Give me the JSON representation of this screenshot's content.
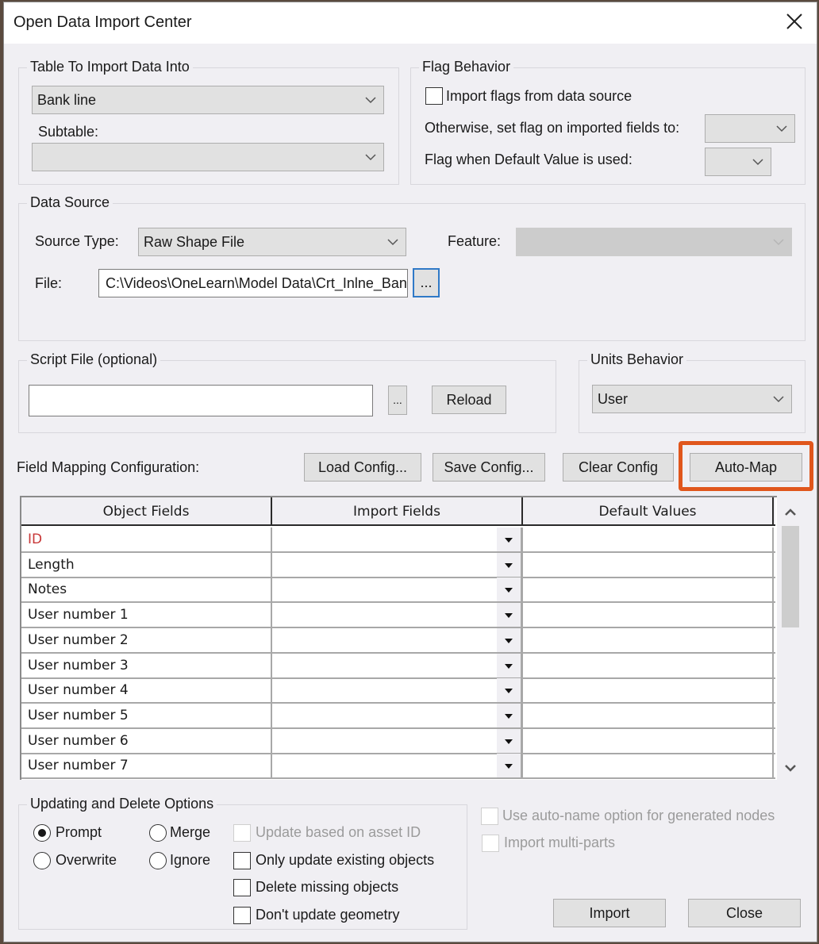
{
  "window": {
    "title": "Open Data Import Center"
  },
  "table_group": {
    "legend": "Table To Import Data Into",
    "table_value": "Bank line",
    "subtable_label": "Subtable:",
    "subtable_value": ""
  },
  "flag_group": {
    "legend": "Flag Behavior",
    "import_flags_label": "Import flags from data source",
    "import_flags_checked": false,
    "otherwise_label": "Otherwise, set flag on imported fields to:",
    "otherwise_value": "",
    "default_used_label": "Flag when Default Value is used:",
    "default_used_value": ""
  },
  "data_source": {
    "legend": "Data Source",
    "source_type_label": "Source Type:",
    "source_type_value": "Raw Shape File",
    "feature_label": "Feature:",
    "feature_value": "",
    "file_label": "File:",
    "file_value": "C:\\Videos\\OneLearn\\Model Data\\Crt_Inlne_Bank",
    "browse_label": "..."
  },
  "script_group": {
    "legend": "Script File (optional)",
    "script_value": "",
    "browse_label": "...",
    "reload_label": "Reload"
  },
  "units_group": {
    "legend": "Units Behavior",
    "units_value": "User"
  },
  "mapping": {
    "label": "Field Mapping Configuration:",
    "load_label": "Load Config...",
    "save_label": "Save Config...",
    "clear_label": "Clear Config",
    "automap_label": "Auto-Map",
    "highlight_color": "#e0561c"
  },
  "grid": {
    "columns": [
      "Object Fields",
      "Import Fields",
      "Default Values"
    ],
    "rows": [
      {
        "object": "ID",
        "import": "",
        "default": "",
        "required": true
      },
      {
        "object": "Length",
        "import": "",
        "default": ""
      },
      {
        "object": "Notes",
        "import": "",
        "default": ""
      },
      {
        "object": "User number 1",
        "import": "",
        "default": ""
      },
      {
        "object": "User number 2",
        "import": "",
        "default": ""
      },
      {
        "object": "User number 3",
        "import": "",
        "default": ""
      },
      {
        "object": "User number 4",
        "import": "",
        "default": ""
      },
      {
        "object": "User number 5",
        "import": "",
        "default": ""
      },
      {
        "object": "User number 6",
        "import": "",
        "default": ""
      },
      {
        "object": "User number 7",
        "import": "",
        "default": ""
      }
    ]
  },
  "update_group": {
    "legend": "Updating and Delete Options",
    "radios": [
      {
        "label": "Prompt",
        "selected": true
      },
      {
        "label": "Merge",
        "selected": false
      },
      {
        "label": "Overwrite",
        "selected": false
      },
      {
        "label": "Ignore",
        "selected": false
      }
    ],
    "checks": [
      {
        "label": "Update based on asset ID",
        "checked": false,
        "disabled": true
      },
      {
        "label": "Only update existing objects",
        "checked": false,
        "disabled": false
      },
      {
        "label": "Delete missing objects",
        "checked": false,
        "disabled": false
      },
      {
        "label": "Don't update geometry",
        "checked": false,
        "disabled": false
      }
    ]
  },
  "extra_options": [
    {
      "label": "Use auto-name option for generated nodes",
      "checked": false,
      "disabled": true
    },
    {
      "label": "Import multi-parts",
      "checked": false,
      "disabled": true
    }
  ],
  "footer": {
    "import_label": "Import",
    "close_label": "Close"
  }
}
